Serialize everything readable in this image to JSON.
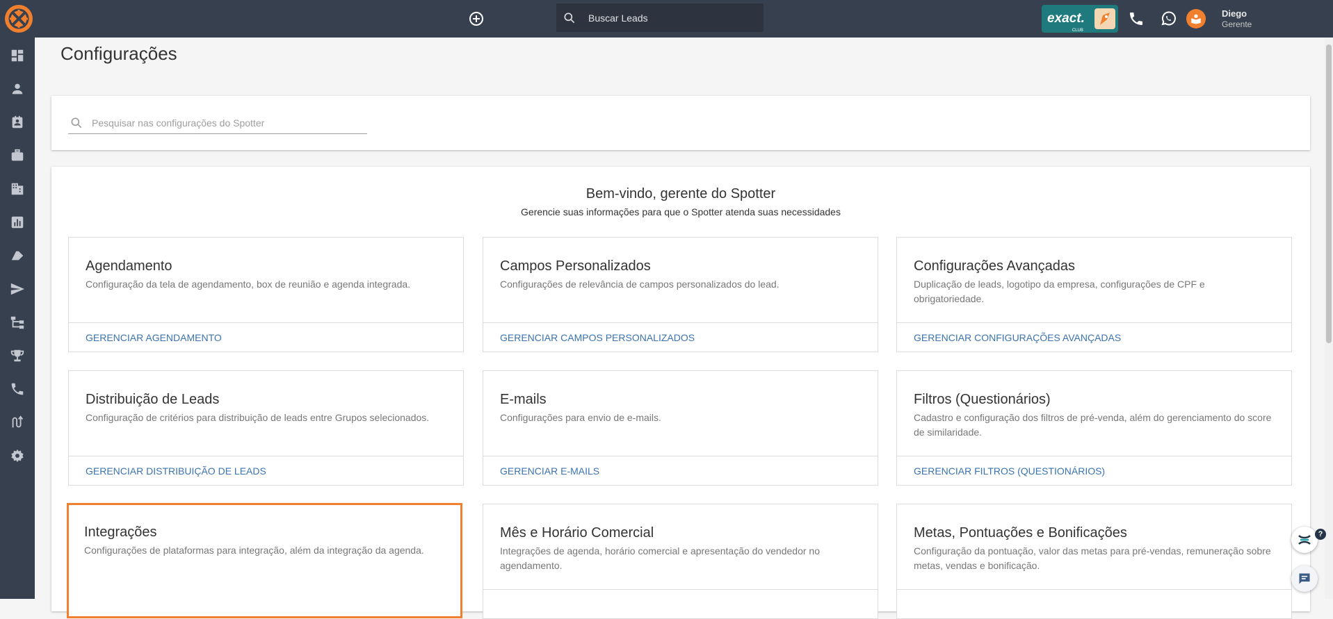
{
  "header": {
    "search_placeholder": "Buscar Leads",
    "brand_badge": "exact.",
    "brand_badge_sub": "CLUB",
    "user_name": "Diego",
    "user_role": "Gerente",
    "accent_color": "#f07f2e",
    "bar_color": "#37404e"
  },
  "sidebar": {
    "items": [
      {
        "icon": "dashboard-icon"
      },
      {
        "icon": "person-icon"
      },
      {
        "icon": "contacts-icon"
      },
      {
        "icon": "briefcase-icon"
      },
      {
        "icon": "building-icon"
      },
      {
        "icon": "bar-chart-icon"
      },
      {
        "icon": "tag-icon"
      },
      {
        "icon": "send-icon"
      },
      {
        "icon": "hierarchy-icon"
      },
      {
        "icon": "trophy-icon"
      },
      {
        "icon": "phone-icon"
      },
      {
        "icon": "route-icon"
      },
      {
        "icon": "settings-icon"
      }
    ]
  },
  "page": {
    "title": "Configurações",
    "search_placeholder": "Pesquisar nas configurações do Spotter",
    "welcome_title": "Bem-vindo, gerente do Spotter",
    "welcome_subtitle": "Gerencie suas informações para que o Spotter atenda suas necessidades"
  },
  "tiles": [
    {
      "title": "Agendamento",
      "description": "Configuração da tela de agendamento, box de reunião e agenda integrada.",
      "link": "GERENCIAR AGENDAMENTO"
    },
    {
      "title": "Campos Personalizados",
      "description": "Configurações de relevância de campos personalizados do lead.",
      "link": "GERENCIAR CAMPOS PERSONALIZADOS"
    },
    {
      "title": "Configurações Avançadas",
      "description": "Duplicação de leads, logotipo da empresa, configurações de CPF e obrigatoriedade.",
      "link": "GERENCIAR CONFIGURAÇÕES AVANÇADAS"
    },
    {
      "title": "Distribuição de Leads",
      "description": "Configuração de critérios para distribuição de leads entre Grupos selecionados.",
      "link": "GERENCIAR DISTRIBUIÇÃO DE LEADS"
    },
    {
      "title": "E-mails",
      "description": "Configurações para envio de e-mails.",
      "link": "GERENCIAR E-MAILS"
    },
    {
      "title": "Filtros (Questionários)",
      "description": "Cadastro e configuração dos filtros de pré-venda, além do gerenciamento do score de similaridade.",
      "link": "GERENCIAR FILTROS (QUESTIONÁRIOS)"
    },
    {
      "title": "Integrações",
      "description": "Configurações de plataformas para integração, além da integração da agenda.",
      "link": "",
      "highlighted": true
    },
    {
      "title": "Mês e Horário Comercial",
      "description": "Integrações de agenda, horário comercial e apresentação do vendedor no agendamento.",
      "link": ""
    },
    {
      "title": "Metas, Pontuações e Bonificações",
      "description": "Configuração da pontuação, valor das metas para pré-vendas, remuneração sobre metas, vendas e bonificação.",
      "link": ""
    }
  ],
  "widgets": {
    "help_badge": "?"
  }
}
